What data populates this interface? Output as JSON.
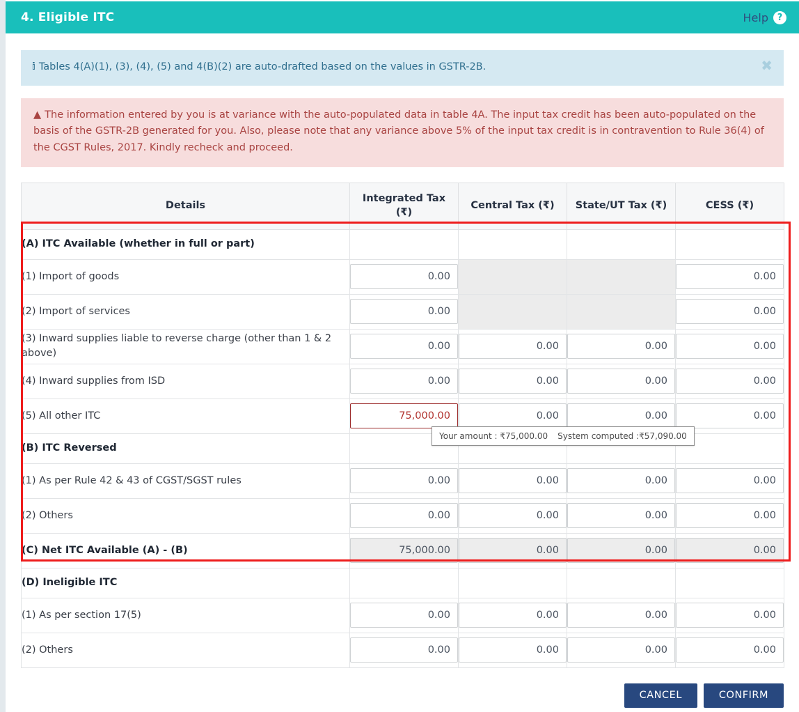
{
  "header": {
    "title": "4. Eligible ITC",
    "help_label": "Help",
    "help_icon": "question-circle-icon",
    "bg_color": "#19bfbb"
  },
  "alerts": {
    "info": {
      "icon": "info-circle-icon",
      "text": "Tables 4(A)(1), (3), (4), (5) and 4(B)(2) are auto-drafted based on the values in GSTR-2B.",
      "close_label": "✖",
      "bg_color": "#d5e9f2",
      "text_color": "#31708f"
    },
    "danger": {
      "icon": "warning-triangle-icon",
      "text": "The information entered by you is at variance with the auto-populated data in table 4A. The input tax credit has been auto-populated on the basis of the GSTR-2B generated for you. Also, please note that any variance above 5% of the input tax credit is in contravention to Rule 36(4) of the CGST Rules, 2017. Kindly recheck and proceed.",
      "bg_color": "#f7dddd",
      "text_color": "#a94442"
    }
  },
  "table": {
    "columns": [
      "Details",
      "Integrated Tax (₹)",
      "Central Tax (₹)",
      "State/UT Tax (₹)",
      "CESS (₹)"
    ],
    "rows": [
      {
        "label": "(A) ITC Available (whether in full or part)",
        "type": "section"
      },
      {
        "label": "(1) Import of goods",
        "type": "input",
        "values": [
          "0.00",
          "",
          "",
          "0.00"
        ],
        "states": [
          "editable",
          "disabled",
          "disabled",
          "editable"
        ]
      },
      {
        "label": "(2) Import of services",
        "type": "input",
        "values": [
          "0.00",
          "",
          "",
          "0.00"
        ],
        "states": [
          "editable",
          "disabled",
          "disabled",
          "editable"
        ]
      },
      {
        "label": "(3) Inward supplies liable to reverse charge (other than 1 & 2 above)",
        "type": "input",
        "values": [
          "0.00",
          "0.00",
          "0.00",
          "0.00"
        ],
        "states": [
          "editable",
          "editable",
          "editable",
          "editable"
        ]
      },
      {
        "label": "(4) Inward supplies from ISD",
        "type": "input",
        "values": [
          "0.00",
          "0.00",
          "0.00",
          "0.00"
        ],
        "states": [
          "editable",
          "editable",
          "editable",
          "editable"
        ]
      },
      {
        "label": "(5) All other ITC",
        "type": "input",
        "values": [
          "75,000.00",
          "0.00",
          "0.00",
          "0.00"
        ],
        "states": [
          "invalid",
          "editable",
          "editable",
          "editable"
        ]
      },
      {
        "label": "(B) ITC Reversed",
        "type": "section"
      },
      {
        "label": "(1) As per Rule 42 & 43 of CGST/SGST rules",
        "type": "input",
        "values": [
          "0.00",
          "0.00",
          "0.00",
          "0.00"
        ],
        "states": [
          "editable",
          "editable",
          "editable",
          "editable"
        ]
      },
      {
        "label": "(2) Others",
        "type": "input",
        "values": [
          "0.00",
          "0.00",
          "0.00",
          "0.00"
        ],
        "states": [
          "editable",
          "editable",
          "editable",
          "editable"
        ]
      },
      {
        "label": "(C) Net ITC Available (A) - (B)",
        "type": "input-head",
        "values": [
          "75,000.00",
          "0.00",
          "0.00",
          "0.00"
        ],
        "states": [
          "readonly",
          "readonly",
          "readonly",
          "readonly"
        ]
      },
      {
        "label": "(D) Ineligible ITC",
        "type": "section"
      },
      {
        "label": "(1) As per section 17(5)",
        "type": "input",
        "values": [
          "0.00",
          "0.00",
          "0.00",
          "0.00"
        ],
        "states": [
          "editable",
          "editable",
          "editable",
          "editable"
        ]
      },
      {
        "label": "(2) Others",
        "type": "input",
        "values": [
          "0.00",
          "0.00",
          "0.00",
          "0.00"
        ],
        "states": [
          "editable",
          "editable",
          "editable",
          "editable"
        ]
      }
    ],
    "highlight_color": "#ee1c1c"
  },
  "tooltip": {
    "your_amount_label": "Your amount : ₹75,000.00",
    "system_computed_label": "System computed :₹57,090.00"
  },
  "footer": {
    "cancel_label": "CANCEL",
    "confirm_label": "CONFIRM",
    "button_color": "#28487f"
  }
}
